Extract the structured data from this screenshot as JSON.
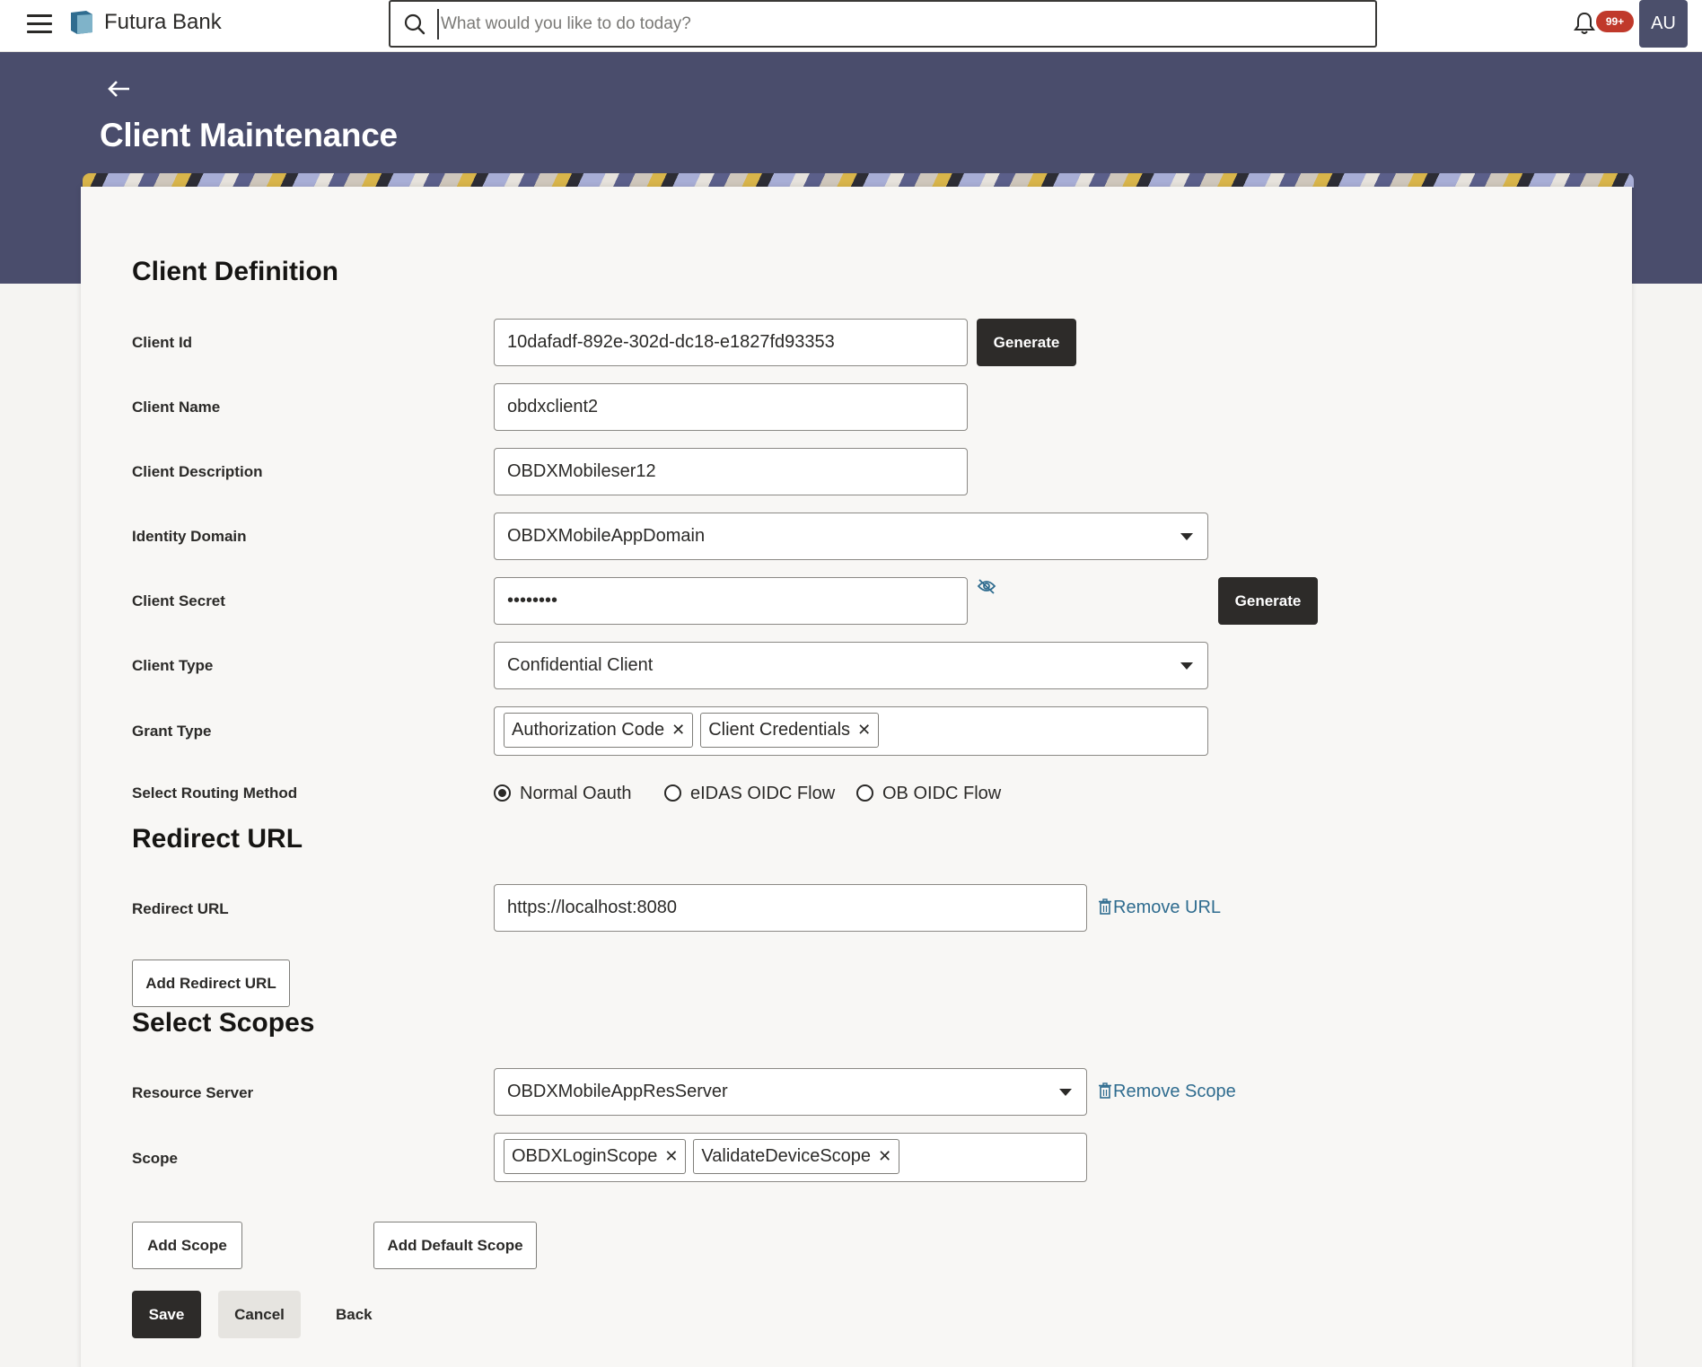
{
  "header": {
    "brand": "Futura Bank",
    "search_placeholder": "What would you like to do today?",
    "notifications_badge": "99+",
    "avatar_initials": "AU"
  },
  "page": {
    "title": "Client Maintenance"
  },
  "client_definition": {
    "section_title": "Client Definition",
    "client_id": {
      "label": "Client Id",
      "value": "10dafadf-892e-302d-dc18-e1827fd93353",
      "button": "Generate"
    },
    "client_name": {
      "label": "Client Name",
      "value": "obdxclient2"
    },
    "client_description": {
      "label": "Client Description",
      "value": "OBDXMobileser12"
    },
    "identity_domain": {
      "label": "Identity Domain",
      "value": "OBDXMobileAppDomain"
    },
    "client_secret": {
      "label": "Client Secret",
      "value": "••••••••",
      "button": "Generate"
    },
    "client_type": {
      "label": "Client Type",
      "value": "Confidential Client"
    },
    "grant_type": {
      "label": "Grant Type",
      "chips": [
        "Authorization Code",
        "Client Credentials"
      ]
    },
    "routing": {
      "label": "Select Routing Method",
      "options": [
        "Normal Oauth",
        "eIDAS OIDC Flow",
        "OB OIDC Flow"
      ],
      "selected": "Normal Oauth"
    }
  },
  "redirect": {
    "section_title": "Redirect URL",
    "label": "Redirect URL",
    "value": "https://localhost:8080",
    "remove_link": "Remove URL",
    "add_button": "Add Redirect URL"
  },
  "scopes": {
    "section_title": "Select Scopes",
    "resource_server": {
      "label": "Resource Server",
      "value": "OBDXMobileAppResServer"
    },
    "remove_link": "Remove Scope",
    "scope": {
      "label": "Scope",
      "chips": [
        "OBDXLoginScope",
        "ValidateDeviceScope"
      ]
    },
    "add_scope_button": "Add Scope",
    "add_default_scope_button": "Add Default Scope"
  },
  "actions": {
    "save": "Save",
    "cancel": "Cancel",
    "back": "Back"
  },
  "colors": {
    "header_band": "#4a4d6c",
    "primary_button": "#2d2b29",
    "link": "#2f6c8f",
    "badge": "#c0392b"
  }
}
